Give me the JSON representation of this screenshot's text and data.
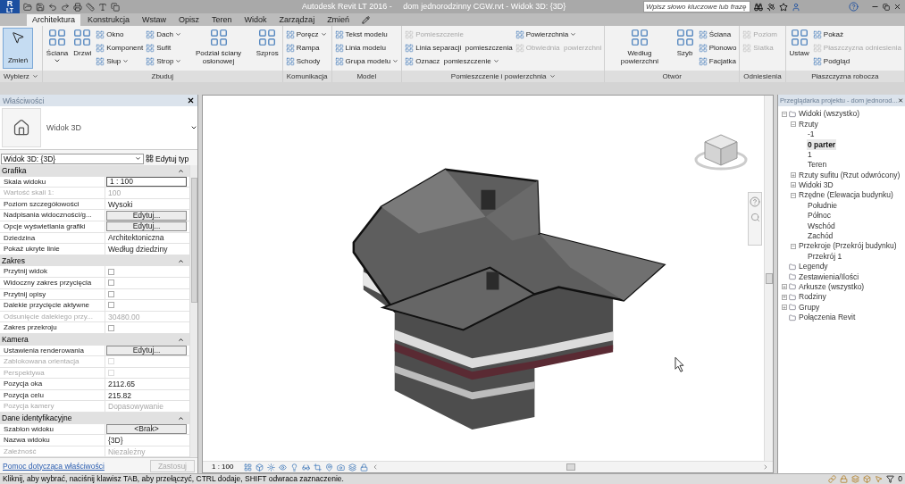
{
  "app_menu": {
    "letter": "R",
    "badge": "LT"
  },
  "title": "Autodesk Revit LT 2016 -     dom jednorodzinny CGW.rvt - Widok 3D: {3D}",
  "search": {
    "placeholder": "Wpisz słowo kluczowe lub frazę"
  },
  "tabs": [
    {
      "label": "Architektura",
      "selected": true
    },
    {
      "label": "Konstrukcja",
      "selected": false
    },
    {
      "label": "Wstaw",
      "selected": false
    },
    {
      "label": "Opisz",
      "selected": false
    },
    {
      "label": "Teren",
      "selected": false
    },
    {
      "label": "Widok",
      "selected": false
    },
    {
      "label": "Zarządzaj",
      "selected": false
    },
    {
      "label": "Zmień",
      "selected": false
    }
  ],
  "ribbon": [
    {
      "label": "Wybierz",
      "dropdown": true,
      "groups": [
        {
          "kind": "select",
          "tools": [
            {
              "label": "Zmień",
              "disabled": false,
              "dropdown": false
            }
          ]
        }
      ]
    },
    {
      "label": "Zbuduj",
      "dropdown": false,
      "groups": [
        {
          "kind": "large",
          "tools": [
            {
              "label": "Ściana",
              "disabled": false,
              "dropdown": true
            }
          ]
        },
        {
          "kind": "large",
          "tools": [
            {
              "label": "Drzwi",
              "disabled": false,
              "dropdown": false
            }
          ]
        },
        {
          "kind": "stack",
          "tools": [
            {
              "label": "Okno",
              "disabled": false,
              "dropdown": false
            },
            {
              "label": "Komponent",
              "disabled": false,
              "dropdown": false
            },
            {
              "label": "Słup",
              "disabled": false,
              "dropdown": true
            }
          ]
        },
        {
          "kind": "stack",
          "tools": [
            {
              "label": "Dach",
              "disabled": false,
              "dropdown": true
            },
            {
              "label": "Sufit",
              "disabled": false,
              "dropdown": false
            },
            {
              "label": "Strop",
              "disabled": false,
              "dropdown": true
            }
          ]
        },
        {
          "kind": "large",
          "tools": [
            {
              "label": "Podział ściany osłonowej",
              "disabled": false,
              "dropdown": false
            }
          ]
        },
        {
          "kind": "large",
          "tools": [
            {
              "label": "Szpros",
              "disabled": false,
              "dropdown": false
            }
          ]
        }
      ]
    },
    {
      "label": "Komunikacja",
      "dropdown": false,
      "groups": [
        {
          "kind": "stack",
          "tools": [
            {
              "label": "Poręcz",
              "disabled": false,
              "dropdown": true
            },
            {
              "label": "Rampa",
              "disabled": false,
              "dropdown": false
            },
            {
              "label": "Schody",
              "disabled": false,
              "dropdown": false
            }
          ]
        }
      ]
    },
    {
      "label": "Model",
      "dropdown": false,
      "groups": [
        {
          "kind": "stack",
          "tools": [
            {
              "label": "Tekst modelu",
              "disabled": false,
              "dropdown": false
            },
            {
              "label": "Linia modelu",
              "disabled": false,
              "dropdown": false
            },
            {
              "label": "Grupa modelu",
              "disabled": false,
              "dropdown": true
            }
          ]
        }
      ]
    },
    {
      "label": "Pomieszczenie i powierzchnia",
      "dropdown": true,
      "groups": [
        {
          "kind": "stack",
          "tools": [
            {
              "label": "Pomieszczenie",
              "disabled": true,
              "dropdown": false
            },
            {
              "label": "Linia separacji  pomieszczenia",
              "disabled": false,
              "dropdown": false
            },
            {
              "label": "Oznacz  pomieszczenie",
              "disabled": false,
              "dropdown": true
            }
          ]
        },
        {
          "kind": "stack",
          "tools": [
            {
              "label": "Powierzchnia",
              "disabled": false,
              "dropdown": true
            },
            {
              "label": "Obwiednia  powierzchni",
              "disabled": true,
              "dropdown": false
            }
          ]
        }
      ]
    },
    {
      "label": "Otwór",
      "dropdown": false,
      "groups": [
        {
          "kind": "large",
          "tools": [
            {
              "label": "Według powierzchni",
              "disabled": false,
              "dropdown": false
            }
          ]
        },
        {
          "kind": "large",
          "tools": [
            {
              "label": "Szyb",
              "disabled": false,
              "dropdown": false
            }
          ]
        },
        {
          "kind": "stack",
          "tools": [
            {
              "label": "Ściana",
              "disabled": false,
              "dropdown": false
            },
            {
              "label": "Pionowo",
              "disabled": false,
              "dropdown": false
            },
            {
              "label": "Facjatka",
              "disabled": false,
              "dropdown": false
            }
          ]
        }
      ]
    },
    {
      "label": "Odniesienia",
      "dropdown": false,
      "groups": [
        {
          "kind": "stack",
          "tools": [
            {
              "label": "Poziom",
              "disabled": true,
              "dropdown": false
            },
            {
              "label": "Siatka",
              "disabled": true,
              "dropdown": false
            }
          ]
        }
      ]
    },
    {
      "label": "Płaszczyzna robocza",
      "dropdown": false,
      "groups": [
        {
          "kind": "large",
          "tools": [
            {
              "label": "Ustaw",
              "disabled": false,
              "dropdown": false
            }
          ]
        },
        {
          "kind": "stack",
          "tools": [
            {
              "label": "Pokaż",
              "disabled": false,
              "dropdown": false
            },
            {
              "label": "Płaszczyzna odniesienia",
              "disabled": true,
              "dropdown": false
            },
            {
              "label": "Podgląd",
              "disabled": false,
              "dropdown": false
            }
          ]
        }
      ]
    }
  ],
  "properties": {
    "title": "Właściwości",
    "type_name": "Widok 3D",
    "type_selector": "Widok 3D: {3D}",
    "edit_type": "Edytuj typ",
    "sections": [
      {
        "label": "Grafika",
        "rows": [
          {
            "label": "Skala widoku",
            "value": "1 : 100",
            "kind": "input",
            "disabled": false
          },
          {
            "label": "Wartość skali   1:",
            "value": "100",
            "kind": "text",
            "disabled": true
          },
          {
            "label": "Poziom szczegółowości",
            "value": "Wysoki",
            "kind": "text",
            "disabled": false
          },
          {
            "label": "Nadpisania widoczności/g...",
            "value": "Edytuj...",
            "kind": "button",
            "disabled": false
          },
          {
            "label": "Opcje wyświetlania grafiki",
            "value": "Edytuj...",
            "kind": "button",
            "disabled": false
          },
          {
            "label": "Dziedzina",
            "value": "Architektoniczna",
            "kind": "text",
            "disabled": false
          },
          {
            "label": "Pokaż ukryte linie",
            "value": "Według dziedziny",
            "kind": "text",
            "disabled": false
          }
        ]
      },
      {
        "label": "Zakres",
        "rows": [
          {
            "label": "Przytnij widok",
            "kind": "checkbox",
            "checked": false,
            "disabled": false
          },
          {
            "label": "Widoczny zakres przycięcia",
            "kind": "checkbox",
            "checked": false,
            "disabled": false
          },
          {
            "label": "Przytnij opisy",
            "kind": "checkbox",
            "checked": false,
            "disabled": false
          },
          {
            "label": "Dalekie przycięcie aktywne",
            "kind": "checkbox",
            "checked": false,
            "disabled": false
          },
          {
            "label": "Odsunięcie dalekiego przy...",
            "value": "30480.00",
            "kind": "text",
            "disabled": true
          },
          {
            "label": "Zakres przekroju",
            "kind": "checkbox",
            "checked": false,
            "disabled": false
          }
        ]
      },
      {
        "label": "Kamera",
        "rows": [
          {
            "label": "Ustawienia renderowania",
            "value": "Edytuj...",
            "kind": "button",
            "disabled": false
          },
          {
            "label": "Zablokowana orientacja",
            "kind": "checkbox",
            "checked": false,
            "disabled": true
          },
          {
            "label": "Perspektywa",
            "kind": "checkbox",
            "checked": false,
            "disabled": true
          },
          {
            "label": "Pozycja oka",
            "value": "2112.65",
            "kind": "text",
            "disabled": false
          },
          {
            "label": "Pozycja celu",
            "value": "215.82",
            "kind": "text",
            "disabled": false
          },
          {
            "label": "Pozycja kamery",
            "value": "Dopasowywanie",
            "kind": "text",
            "disabled": true
          }
        ]
      },
      {
        "label": "Dane identyfikacyjne",
        "rows": [
          {
            "label": "Szablon widoku",
            "value": "<Brak>",
            "kind": "button",
            "disabled": false
          },
          {
            "label": "Nazwa widoku",
            "value": "{3D}",
            "kind": "text",
            "disabled": false
          },
          {
            "label": "Zależność",
            "value": "Niezależny",
            "kind": "text",
            "disabled": true
          }
        ]
      }
    ],
    "help_link": "Pomoc dotycząca właściwości",
    "apply": {
      "label": "Zastosuj",
      "disabled": true
    }
  },
  "view_scale": "1 : 100",
  "browser": {
    "title": "Przeglądarka projektu - dom jednorod...",
    "tree": [
      {
        "label": "Widoki (wszystko)",
        "expanded": true,
        "selected": false,
        "children": [
          {
            "label": "Rzuty",
            "expanded": true,
            "selected": false,
            "children": [
              {
                "label": "-1",
                "selected": false
              },
              {
                "label": "0 parter",
                "selected": true
              },
              {
                "label": "1",
                "selected": false
              },
              {
                "label": "Teren",
                "selected": false
              }
            ]
          },
          {
            "label": "Rzuty sufitu (Rzut odwrócony)",
            "expanded": false,
            "selected": false
          },
          {
            "label": "Widoki 3D",
            "expanded": false,
            "selected": false
          },
          {
            "label": "Rzędne (Elewacja budynku)",
            "expanded": true,
            "selected": false,
            "children": [
              {
                "label": "Południe",
                "selected": false
              },
              {
                "label": "Północ",
                "selected": false
              },
              {
                "label": "Wschód",
                "selected": false
              },
              {
                "label": "Zachód",
                "selected": false
              }
            ]
          },
          {
            "label": "Przekroje (Przekrój budynku)",
            "expanded": true,
            "selected": false,
            "children": [
              {
                "label": "Przekrój 1",
                "selected": false
              }
            ]
          }
        ]
      },
      {
        "label": "Legendy",
        "selected": false
      },
      {
        "label": "Zestawienia/Ilości",
        "selected": false
      },
      {
        "label": "Arkusze (wszystko)",
        "expanded": false,
        "selected": false
      },
      {
        "label": "Rodziny",
        "expanded": false,
        "selected": false
      },
      {
        "label": "Grupy",
        "expanded": false,
        "selected": false
      },
      {
        "label": "Połączenia Revit",
        "selected": false
      }
    ]
  },
  "status": {
    "text": "Kliknij, aby wybrać, naciśnij klawisz TAB, aby przełączyć, CTRL dodaje, SHIFT odwraca zaznaczenie.",
    "selection_count": "0"
  }
}
